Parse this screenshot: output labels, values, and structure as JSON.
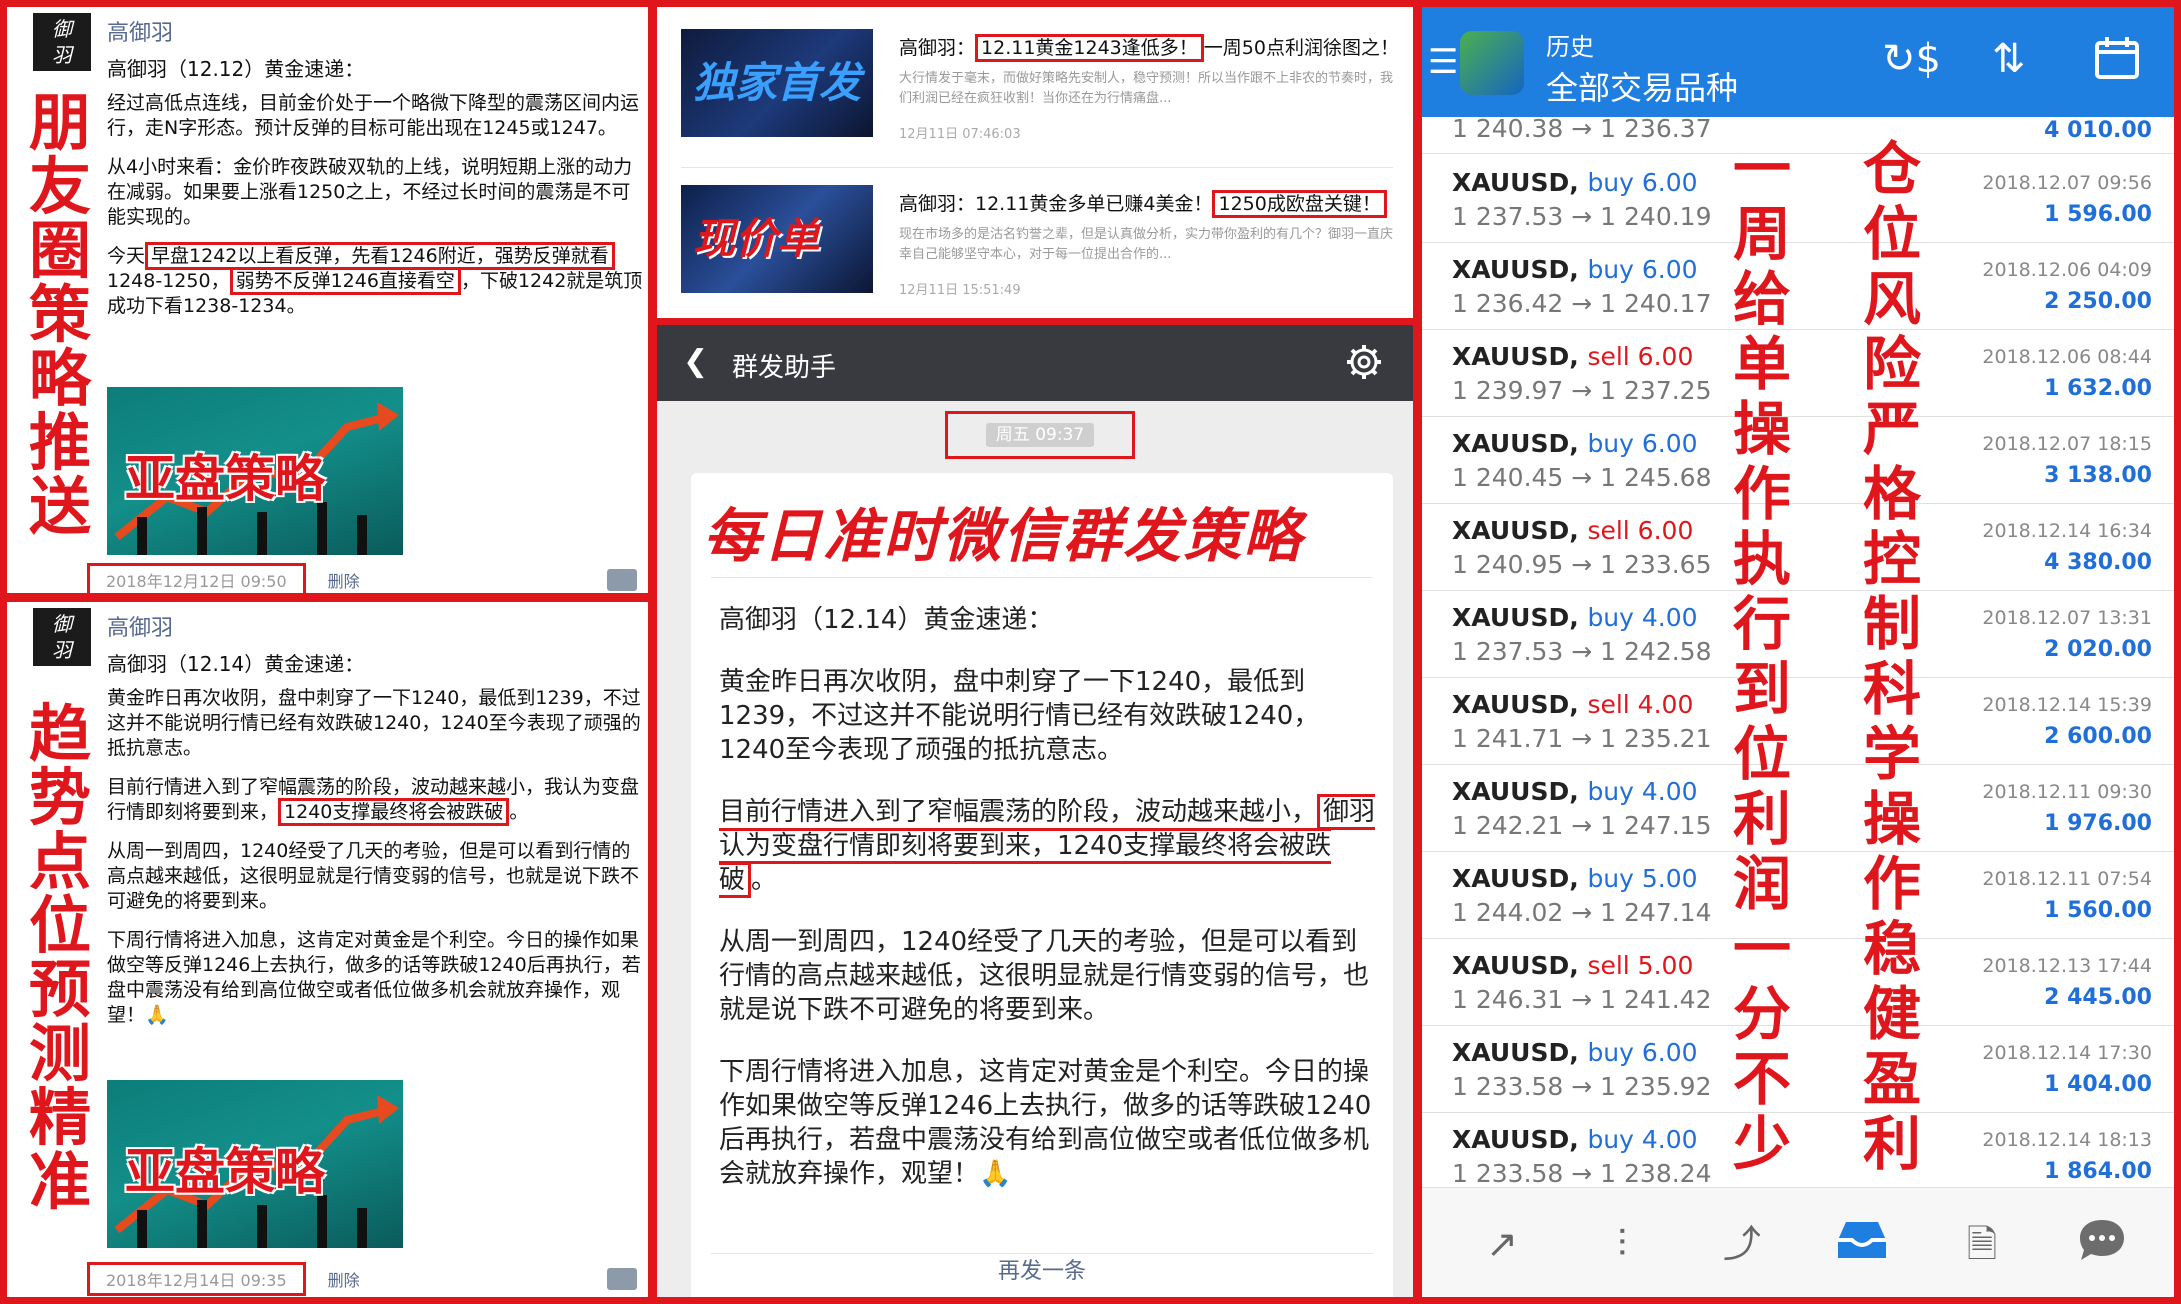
{
  "left_top": {
    "vertical_caption": "朋友圈策略推送",
    "author": "高御羽",
    "title": "高御羽（12.12）黄金速递：",
    "para1": "经过高低点连线，目前金价处于一个略微下降型的震荡区间内运行，走N字形态。预计反弹的目标可能出现在1245或1247。",
    "para2": "从4小时来看：金价昨夜跌破双轨的上线，说明短期上涨的动力在减弱。如果要上涨看1250之上，不经过长时间的震荡是不可能实现的。",
    "para3_a": "今天",
    "para3_box1": "早盘1242以上看反弹，先看1246附近，强势反弹就看",
    "para3_b": "1248-1250，",
    "para3_box2": "弱势不反弹1246直接看空",
    "para3_c": "，下破1242就是筑顶成功下看1238-1234。",
    "banner": "亚盘策略",
    "timestamp": "2018年12月12日 09:50",
    "delete": "删除"
  },
  "left_bottom": {
    "vertical_caption": "趋势点位预测精准",
    "author": "高御羽",
    "title": "高御羽（12.14）黄金速递：",
    "para1": "黄金昨日再次收阴，盘中刺穿了一下1240，最低到1239，不过这并不能说明行情已经有效跌破1240，1240至今表现了顽强的抵抗意志。",
    "para2_a": "目前行情进入到了窄幅震荡的阶段，波动越来越小，我认为变盘行情即刻将要到来，",
    "para2_box": "1240支撑最终将会被跌破",
    "para2_b": "。",
    "para3": "从周一到周四，1240经受了几天的考验，但是可以看到行情的高点越来越低，这很明显就是行情变弱的信号，也就是说下跌不可避免的将要到来。",
    "para4": "下周行情将进入加息，这肯定对黄金是个利空。今日的操作如果做空等反弹1246上去执行，做多的话等跌破1240后再执行，若盘中震荡没有给到高位做空或者低位做多机会就放弃操作，观望！🙏",
    "banner": "亚盘策略",
    "timestamp": "2018年12月14日 09:35",
    "delete": "删除"
  },
  "articles": [
    {
      "thumb_text": "独家首发",
      "title_a": "高御羽：",
      "title_box": "12.11黄金1243逢低多！",
      "title_b": "一周50点利润徐图之！",
      "summary": "大行情发于毫末，而做好策略先安制人，稳守预测！所以当作跟不上非农的节奏时，我们利润已经在疯狂收割！当你还在为行情痛盘...",
      "time": "12月11日 07:46:03"
    },
    {
      "thumb_text": "现价单",
      "title_a": "高御羽：12.11黄金多单已赚4美金！",
      "title_box": "1250成欧盘关键！",
      "title_b": "",
      "summary": "现在市场多的是沽名钓誉之辈，但是认真做分析，实力带你盈利的有几个？御羽一直庆幸自己能够坚守本心，对于每一位提出合作的...",
      "time": "12月11日 15:51:49"
    }
  ],
  "group_send": {
    "header_title": "群发助手",
    "time": "周五 09:37",
    "headline": "每日准时微信群发策略",
    "msg_title": "高御羽（12.14）黄金速递：",
    "p1": "黄金昨日再次收阴，盘中刺穿了一下1240，最低到1239，不过这并不能说明行情已经有效跌破1240，1240至今表现了顽强的抵抗意志。",
    "p2_a": "目前行情进入到了窄幅震荡的阶段，波动越来越小，",
    "p2_box": "御羽认为变盘行情即刻将要到来，1240支撑最终将会被跌破",
    "p2_b": "。",
    "p3": "从周一到周四，1240经受了几天的考验，但是可以看到行情的高点越来越低，这很明显就是行情变弱的信号，也就是说下跌不可避免的将要到来。",
    "p4": "下周行情将进入加息，这肯定对黄金是个利空。今日的操作如果做空等反弹1246上去执行，做多的话等跌破1240后再执行，若盘中震荡没有给到高位做空或者低位做多机会就放弃操作，观望！🙏",
    "send_again": "再发一条"
  },
  "mt4": {
    "header_sub": "历史",
    "header_main": "全部交易品种",
    "first_row": {
      "prices": "1 240.38 → 1 236.37",
      "profit": "4 010.00"
    },
    "trades": [
      {
        "symbol": "XAUUSD,",
        "side": "buy 6.00",
        "prices": "1 237.53 → 1 240.19",
        "date": "2018.12.07 09:56",
        "profit": "1 596.00"
      },
      {
        "symbol": "XAUUSD,",
        "side": "buy 6.00",
        "prices": "1 236.42 → 1 240.17",
        "date": "2018.12.06 04:09",
        "profit": "2 250.00"
      },
      {
        "symbol": "XAUUSD,",
        "side": "sell 6.00",
        "prices": "1 239.97 → 1 237.25",
        "date": "2018.12.06 08:44",
        "profit": "1 632.00"
      },
      {
        "symbol": "XAUUSD,",
        "side": "buy 6.00",
        "prices": "1 240.45 → 1 245.68",
        "date": "2018.12.07 18:15",
        "profit": "3 138.00"
      },
      {
        "symbol": "XAUUSD,",
        "side": "sell 6.00",
        "prices": "1 240.95 → 1 233.65",
        "date": "2018.12.14 16:34",
        "profit": "4 380.00"
      },
      {
        "symbol": "XAUUSD,",
        "side": "buy 4.00",
        "prices": "1 237.53 → 1 242.58",
        "date": "2018.12.07 13:31",
        "profit": "2 020.00"
      },
      {
        "symbol": "XAUUSD,",
        "side": "sell 4.00",
        "prices": "1 241.71 → 1 235.21",
        "date": "2018.12.14 15:39",
        "profit": "2 600.00"
      },
      {
        "symbol": "XAUUSD,",
        "side": "buy 4.00",
        "prices": "1 242.21 → 1 247.15",
        "date": "2018.12.11 09:30",
        "profit": "1 976.00"
      },
      {
        "symbol": "XAUUSD,",
        "side": "buy 5.00",
        "prices": "1 244.02 → 1 247.14",
        "date": "2018.12.11 07:54",
        "profit": "1 560.00"
      },
      {
        "symbol": "XAUUSD,",
        "side": "sell 5.00",
        "prices": "1 246.31 → 1 241.42",
        "date": "2018.12.13 17:44",
        "profit": "2 445.00"
      },
      {
        "symbol": "XAUUSD,",
        "side": "buy 6.00",
        "prices": "1 233.58 → 1 235.92",
        "date": "2018.12.14 17:30",
        "profit": "1 404.00"
      },
      {
        "symbol": "XAUUSD,",
        "side": "buy 4.00",
        "prices": "1 233.58 → 1 238.24",
        "date": "2018.12.14 18:13",
        "profit": "1 864.00"
      }
    ],
    "caption_left": "一周给单操作执行到位利润一分不少",
    "caption_right": "仓位风险严格控制科学操作稳健盈利",
    "icons": [
      "quotes-icon",
      "chart-icon",
      "trade-icon",
      "history-icon",
      "news-icon",
      "chat-icon"
    ]
  },
  "colors": {
    "red": "#e0161d",
    "blue": "#1e7fe1",
    "buy": "#1e6fd9"
  }
}
